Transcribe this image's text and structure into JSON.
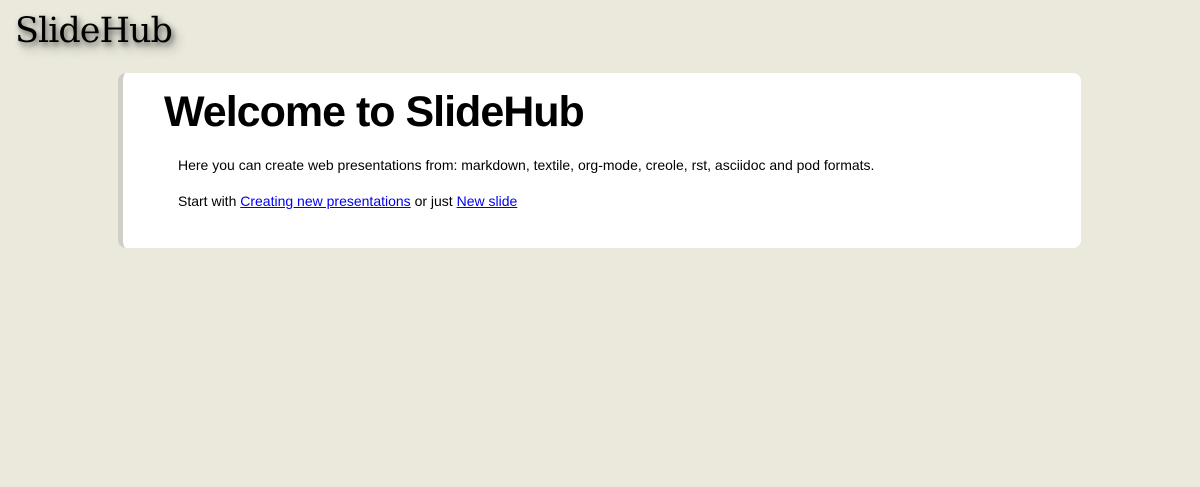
{
  "header": {
    "logo_text": "SlideHub"
  },
  "welcome": {
    "title": "Welcome to SlideHub",
    "intro": "Here you can create web presentations from: markdown, textile, org-mode, creole, rst, asciidoc and pod formats.",
    "start_prefix": "Start with ",
    "create_link": "Creating new presentations",
    "middle_text": " or just ",
    "new_slide_link": "New slide"
  },
  "colors": {
    "background": "#eae9dc",
    "card": "#ffffff",
    "link": "#0000ee"
  }
}
